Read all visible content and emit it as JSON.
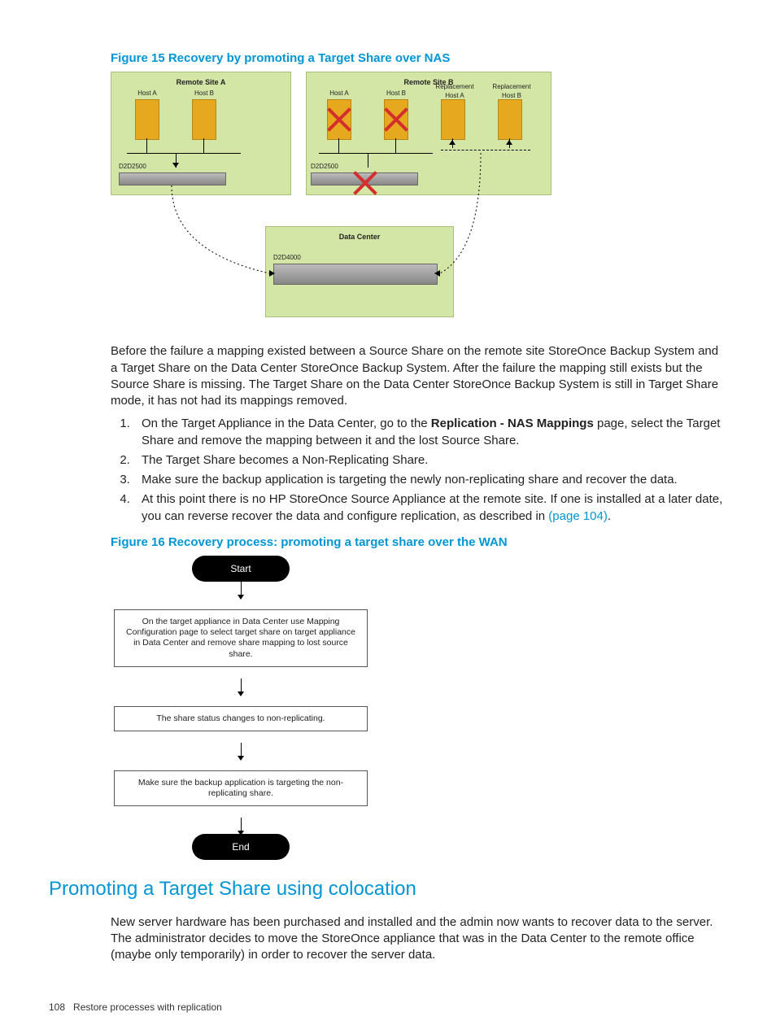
{
  "figure15": {
    "caption": "Figure 15 Recovery by promoting a Target Share over NAS",
    "siteA": {
      "title": "Remote Site A",
      "hostA": "Host A",
      "hostB": "Host B",
      "device": "D2D2500"
    },
    "siteB": {
      "title": "Remote Site B",
      "hostA": "Host A",
      "hostB": "Host B",
      "repA": "Replacement\nHost A",
      "repB": "Replacement\nHost B",
      "device": "D2D2500"
    },
    "dc": {
      "title": "Data Center",
      "device": "D2D4000"
    }
  },
  "para1": "Before the failure a mapping existed between a Source Share on the remote site StoreOnce Backup System and a Target Share on the Data Center StoreOnce Backup System. After the failure the mapping still exists but the Source Share is missing. The Target Share on the Data Center StoreOnce Backup System is still in Target Share mode, it has not had its mappings removed.",
  "steps": [
    {
      "pre": "On the Target Appliance in the Data Center, go to the ",
      "bold": "Replication - NAS Mappings",
      "post": " page, select the Target Share and remove the mapping between it and the lost Source Share."
    },
    {
      "pre": "The Target Share becomes a Non-Replicating Share.",
      "bold": "",
      "post": ""
    },
    {
      "pre": "Make sure the backup application is targeting the newly non-replicating share and recover the data.",
      "bold": "",
      "post": ""
    },
    {
      "pre": "At this point there is no HP StoreOnce Source Appliance at the remote site. If one is installed at a later date, you can reverse recover the data and configure replication, as described in ",
      "bold": "",
      "post": "",
      "link": "(page 104)",
      "tail": "."
    }
  ],
  "figure16": {
    "caption": "Figure 16 Recovery process: promoting a target share over the WAN"
  },
  "flow": {
    "start": "Start",
    "box1": "On the target appliance in Data Center use Mapping Configuration page to select target share on target appliance in Data Center and remove share mapping to lost source share.",
    "box2": "The share status changes to non-replicating.",
    "box3": "Make sure the backup application is targeting the non-replicating share.",
    "end": "End"
  },
  "section": "Promoting a Target Share using colocation",
  "para2": "New server hardware has been purchased and installed and the admin now wants to recover data to the server. The administrator decides to move the StoreOnce appliance that was in the Data Center to the remote office (maybe only temporarily) in order to recover the server data.",
  "footer": {
    "page": "108",
    "title": "Restore processes with replication"
  }
}
